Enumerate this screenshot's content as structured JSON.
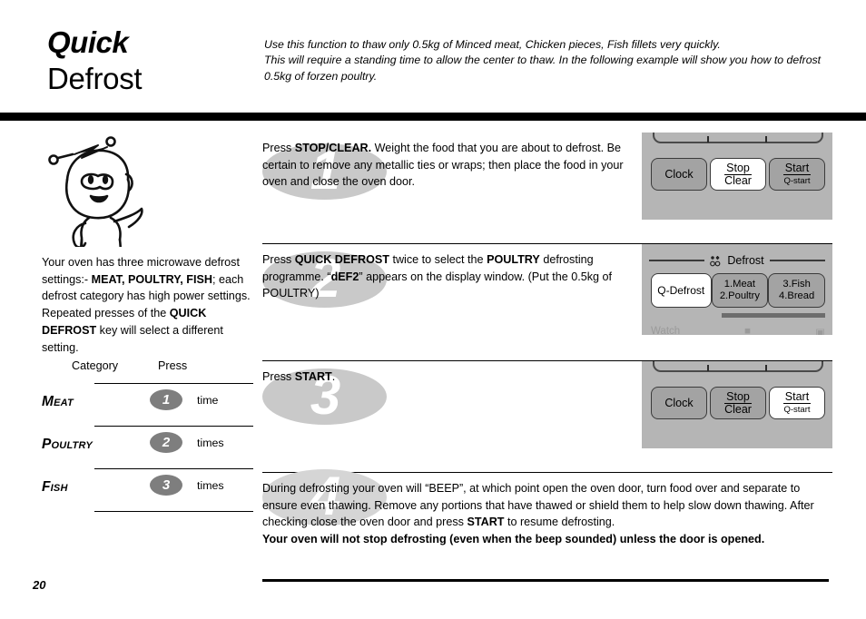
{
  "title": {
    "line1": "Quick",
    "line2": "Defrost"
  },
  "intro": {
    "line1": "Use this function to thaw only 0.5kg of Minced meat, Chicken pieces, Fish fillets very quickly.",
    "line2": "This will require a standing time to allow the center to thaw. In the following example will show you how to defrost",
    "line3": "0.5kg of forzen poultry."
  },
  "side_note": {
    "part1": "Your oven has three microwave defrost settings:- ",
    "bold1": "MEAT, POULTRY, FISH",
    "part2": "; each defrost category has high power settings. Repeated presses of the ",
    "bold2": "QUICK DEFROST",
    "part3": " key will select a different setting."
  },
  "category_table": {
    "header_category": "Category",
    "header_press": "Press",
    "rows": [
      {
        "name": "Meat",
        "count": "1",
        "unit": "time"
      },
      {
        "name": "Poultry",
        "count": "2",
        "unit": "times"
      },
      {
        "name": "Fish",
        "count": "3",
        "unit": "times"
      }
    ]
  },
  "steps": [
    {
      "number": "1",
      "text_part1": "Press ",
      "bold1": "STOP/CLEAR.",
      "text_part2": " Weight the food that you are about to defrost. Be certain to remove any metallic ties or wraps; then place the food in your oven and close the oven door."
    },
    {
      "number": "2",
      "text_part1": "Press ",
      "bold1": "QUICK DEFROST",
      "text_part2": " twice to select the ",
      "bold2": "POULTRY",
      "text_part3": " defrosting programme. “",
      "bold3": "dEF2",
      "text_part4": "” appears on the display window. (Put the 0.5kg of POULTRY)"
    },
    {
      "number": "3",
      "text_part1": "Press ",
      "bold1": "START",
      "text_part2": "."
    },
    {
      "number": "4",
      "text_part1": "During defrosting your oven will “BEEP”, at which point open the oven door, turn food over and separate to ensure even thawing. Remove any portions that have thawed or shield them to help slow down thawing. After checking close the oven door and press ",
      "bold1": "START",
      "text_part2": " to resume defrosting.",
      "final_note": "Your oven will not stop defrosting (even when the beep sounded) unless the door is opened."
    }
  ],
  "panels": {
    "panel1": {
      "buttons": [
        {
          "label": "Clock",
          "lit": false
        },
        {
          "top": "Stop",
          "sub": "Clear",
          "lit": true
        },
        {
          "top": "Start",
          "sub": "Q-start",
          "lit": false
        }
      ]
    },
    "panel2": {
      "section_label": "Defrost",
      "q_defrost": "Q-Defrost",
      "pad_left_line1": "1.Meat",
      "pad_left_line2": "2.Poultry",
      "pad_right_line1": "3.Fish",
      "pad_right_line2": "4.Bread",
      "foot_label": "Watch"
    },
    "panel3": {
      "buttons": [
        {
          "label": "Clock",
          "lit": false
        },
        {
          "top": "Stop",
          "sub": "Clear",
          "lit": false
        },
        {
          "top": "Start",
          "sub": "Q-start",
          "lit": true
        }
      ]
    }
  },
  "footer": {
    "page_number": "20"
  },
  "colors": {
    "panel_bg": "#b5b5b5",
    "button_bg": "#a3a3a3",
    "button_lit": "#ffffff",
    "watermark": "#c9c9c9",
    "badge": "#7e7e7e"
  }
}
